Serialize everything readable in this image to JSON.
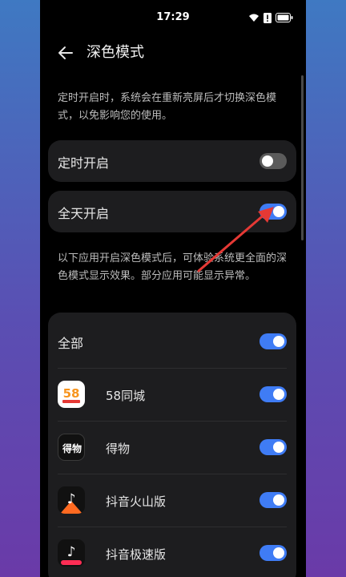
{
  "status_bar": {
    "time": "17:29"
  },
  "header": {
    "title": "深色模式"
  },
  "schedule_desc": "定时开启时，系统会在重新亮屏后才切换深色模式，以免影响您的使用。",
  "settings": [
    {
      "label": "定时开启",
      "enabled": false
    },
    {
      "label": "全天开启",
      "enabled": true
    }
  ],
  "apps_desc": "以下应用开启深色模式后，可体验系统更全面的深色模式显示效果。部分应用可能显示异常。",
  "apps": {
    "all_label": "全部",
    "all_enabled": true,
    "items": [
      {
        "name": "58同城",
        "icon": "58-tongcheng-icon",
        "icon_text": "58",
        "enabled": true
      },
      {
        "name": "得物",
        "icon": "dewu-icon",
        "icon_text": "得物",
        "enabled": true
      },
      {
        "name": "抖音火山版",
        "icon": "douyin-huoshan-icon",
        "icon_text": "♪",
        "enabled": true
      },
      {
        "name": "抖音极速版",
        "icon": "douyin-jisu-icon",
        "icon_text": "♪",
        "enabled": true
      }
    ]
  },
  "colors": {
    "toggle_on": "#3f7cf5",
    "toggle_off": "#5b5b5b",
    "card_bg": "#1d1d1f",
    "annotation_arrow": "#e53935"
  }
}
